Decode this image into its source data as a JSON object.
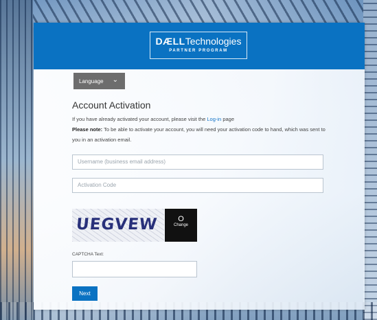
{
  "header": {
    "logo_dell": "DÆLL",
    "logo_technologies": "Technologies",
    "logo_subtitle": "PARTNER PROGRAM"
  },
  "language": {
    "label": "Language",
    "chevron": "⌄"
  },
  "form": {
    "title": "Account Activation",
    "info_prefix": "If you have already activated your account, please visit the ",
    "info_link": "Log-in",
    "info_suffix": " page",
    "note_label": "Please note:",
    "note_text": " To be able to activate your account, you will need your activation code to hand, which was sent to you in an activation email.",
    "username_placeholder": "Username (business email address)",
    "activation_placeholder": "Activation Code",
    "captcha_text": "UEGVEW",
    "captcha_change_icon": "O",
    "captcha_change_label": "Change",
    "captcha_field_label": "CAPTCHA Text:",
    "next_label": "Next"
  },
  "colors": {
    "header_blue": "#0a72c2",
    "link_blue": "#1173c6",
    "language_gray": "#6d6d6d",
    "captcha_button": "#111111"
  }
}
